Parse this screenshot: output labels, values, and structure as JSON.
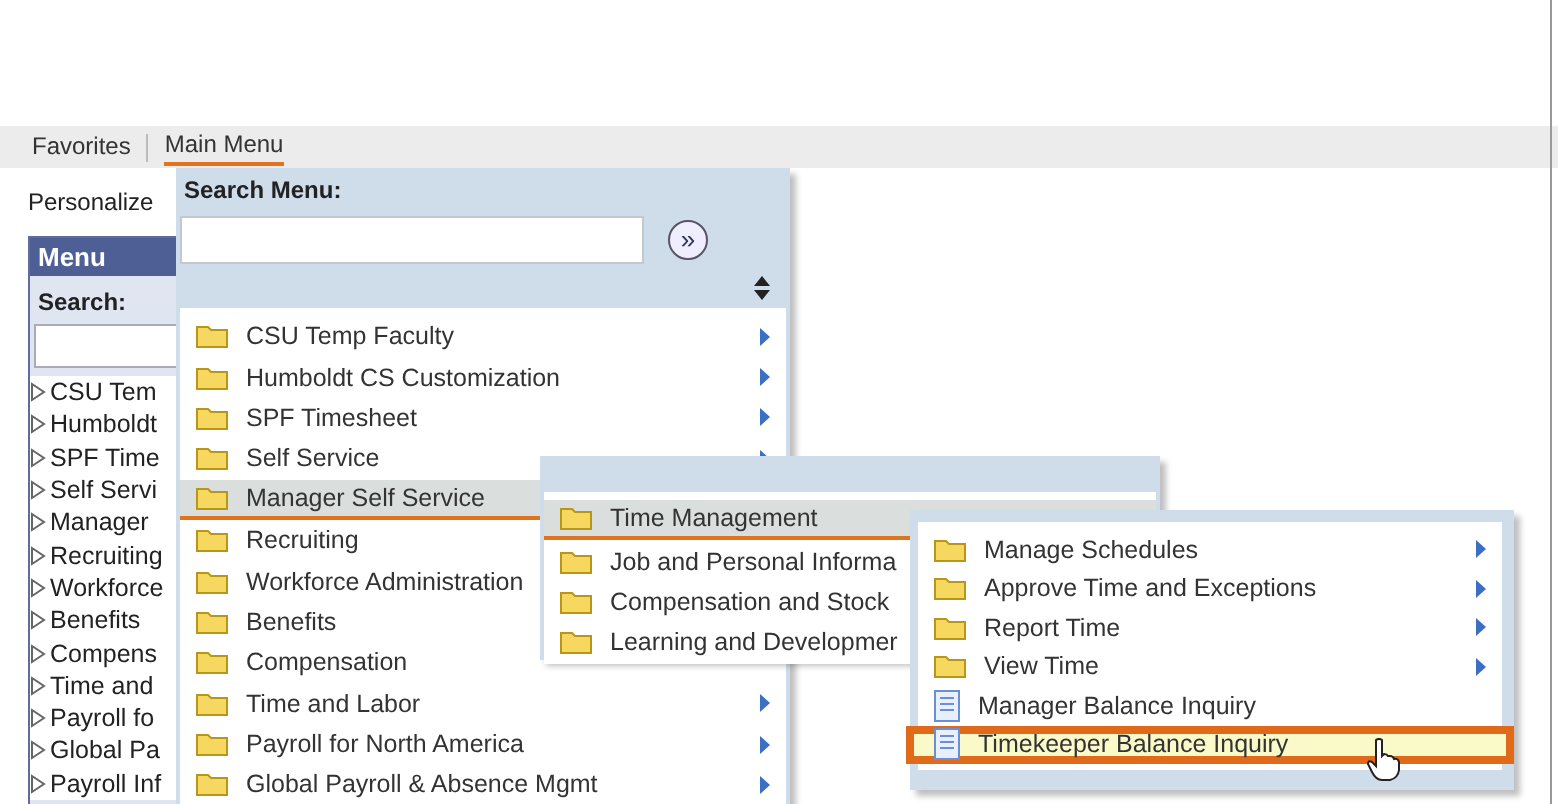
{
  "nav": [
    {
      "label": "Favorites",
      "selected": false
    },
    {
      "label": "Main Menu",
      "selected": true
    }
  ],
  "personalize": "Personalize",
  "menu_panel": {
    "title": "Menu",
    "search_label": "Search:",
    "items": [
      "CSU Tem",
      "Humboldt",
      "SPF Time",
      "Self Servi",
      "Manager",
      "Recruiting",
      "Workforce",
      "Benefits",
      "Compens",
      "Time and",
      "Payroll fo",
      "Global Pa",
      "Payroll Inf"
    ]
  },
  "search_menu": {
    "label": "Search Menu:",
    "go": "»"
  },
  "menus": [
    {
      "items": [
        {
          "label": "CSU Temp Faculty",
          "kind": "folder",
          "arrow": true,
          "selected": false
        },
        {
          "label": "Humboldt CS Customization",
          "kind": "folder",
          "arrow": true,
          "selected": false
        },
        {
          "label": "SPF Timesheet",
          "kind": "folder",
          "arrow": true,
          "selected": false
        },
        {
          "label": "Self Service",
          "kind": "folder",
          "arrow": true,
          "selected": false
        },
        {
          "label": "Manager Self Service",
          "kind": "folder",
          "arrow": false,
          "selected": true
        },
        {
          "label": "Recruiting",
          "kind": "folder",
          "arrow": false,
          "selected": false
        },
        {
          "label": "Workforce Administration",
          "kind": "folder",
          "arrow": false,
          "selected": false
        },
        {
          "label": "Benefits",
          "kind": "folder",
          "arrow": false,
          "selected": false
        },
        {
          "label": "Compensation",
          "kind": "folder",
          "arrow": false,
          "selected": false
        },
        {
          "label": "Time and Labor",
          "kind": "folder",
          "arrow": true,
          "selected": false
        },
        {
          "label": "Payroll for North America",
          "kind": "folder",
          "arrow": true,
          "selected": false
        },
        {
          "label": "Global Payroll & Absence Mgmt",
          "kind": "folder",
          "arrow": true,
          "selected": false
        }
      ]
    },
    {
      "items": [
        {
          "label": "Time Management",
          "kind": "folder",
          "arrow": false,
          "selected": true
        },
        {
          "label": "Job and Personal Informa",
          "kind": "folder",
          "arrow": false,
          "selected": false
        },
        {
          "label": "Compensation and Stock",
          "kind": "folder",
          "arrow": false,
          "selected": false
        },
        {
          "label": "Learning and Developmer",
          "kind": "folder",
          "arrow": false,
          "selected": false
        }
      ]
    },
    {
      "items": [
        {
          "label": "Manage Schedules",
          "kind": "folder",
          "arrow": true,
          "selected": false
        },
        {
          "label": "Approve Time and Exceptions",
          "kind": "folder",
          "arrow": true,
          "selected": false
        },
        {
          "label": "Report Time",
          "kind": "folder",
          "arrow": true,
          "selected": false
        },
        {
          "label": "View Time",
          "kind": "folder",
          "arrow": true,
          "selected": false
        },
        {
          "label": "Manager Balance Inquiry",
          "kind": "page",
          "arrow": false,
          "selected": false
        },
        {
          "label": "Timekeeper Balance Inquiry",
          "kind": "page",
          "arrow": false,
          "selected": true
        }
      ]
    }
  ]
}
